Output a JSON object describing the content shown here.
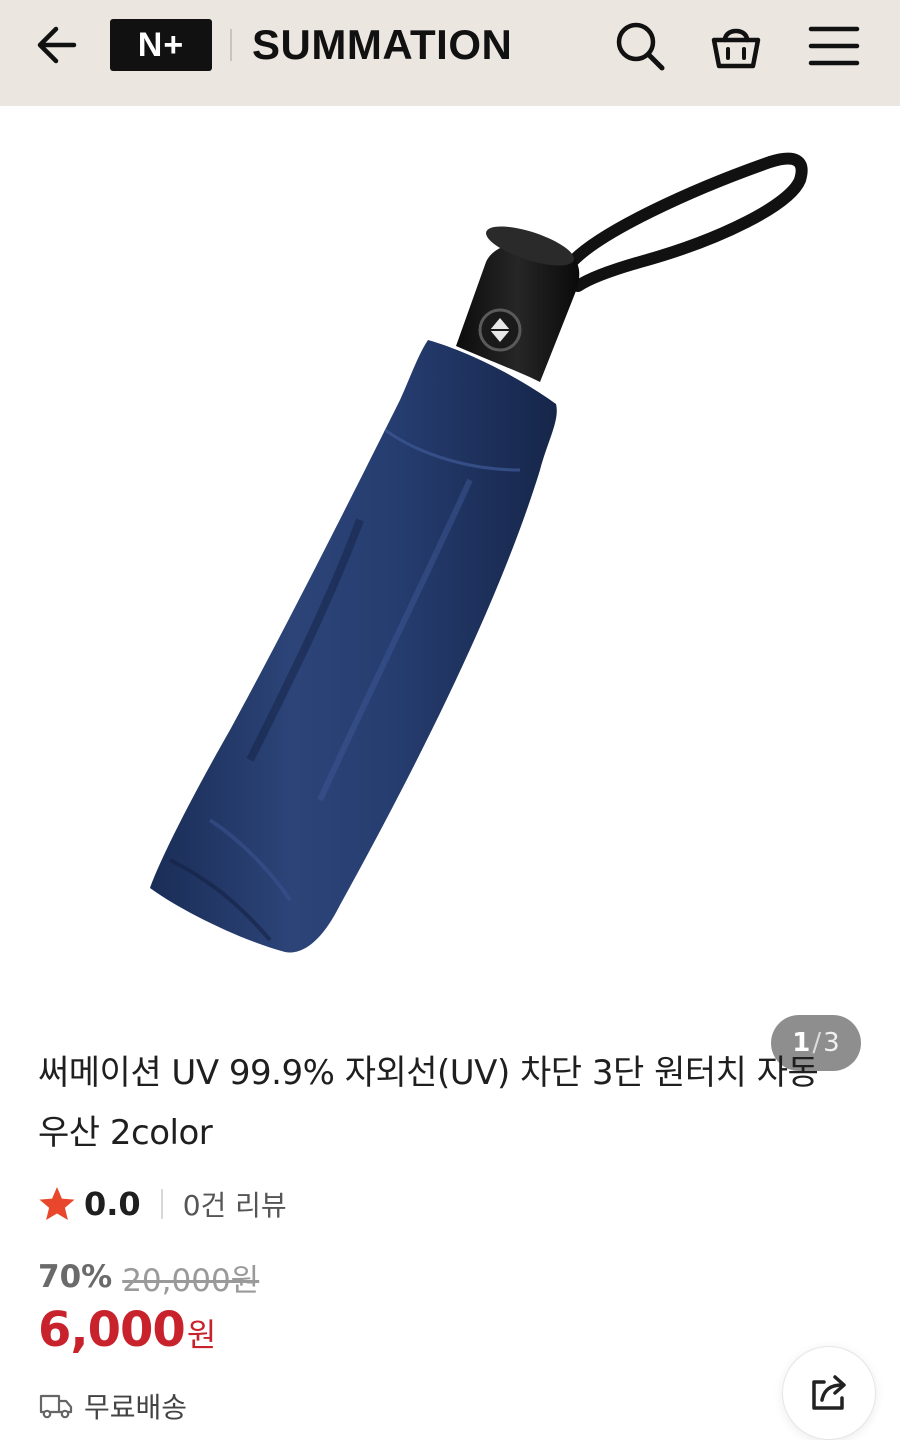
{
  "header": {
    "logo_text": "N+",
    "brand_name": "SUMMATION",
    "back_icon": "arrow-left-icon",
    "search_icon": "search-icon",
    "cart_icon": "shopping-basket-icon",
    "menu_icon": "hamburger-menu-icon"
  },
  "gallery": {
    "current": "1",
    "separator": "/",
    "total": "3",
    "product_color": "#243a6b"
  },
  "product": {
    "title": "써메이션 UV 99.9% 자외선(UV) 차단 3단 원터치 자동 우산 2color",
    "rating": "0.0",
    "review_label": "0건 리뷰",
    "discount_rate": "70%",
    "original_price": "20,000원",
    "sale_price": "6,000",
    "price_unit": "원",
    "shipping": "무료배송"
  },
  "colors": {
    "header_bg": "#ebe6df",
    "accent_red": "#c8232c",
    "star": "#e8472b"
  },
  "actions": {
    "share_icon": "share-icon"
  }
}
